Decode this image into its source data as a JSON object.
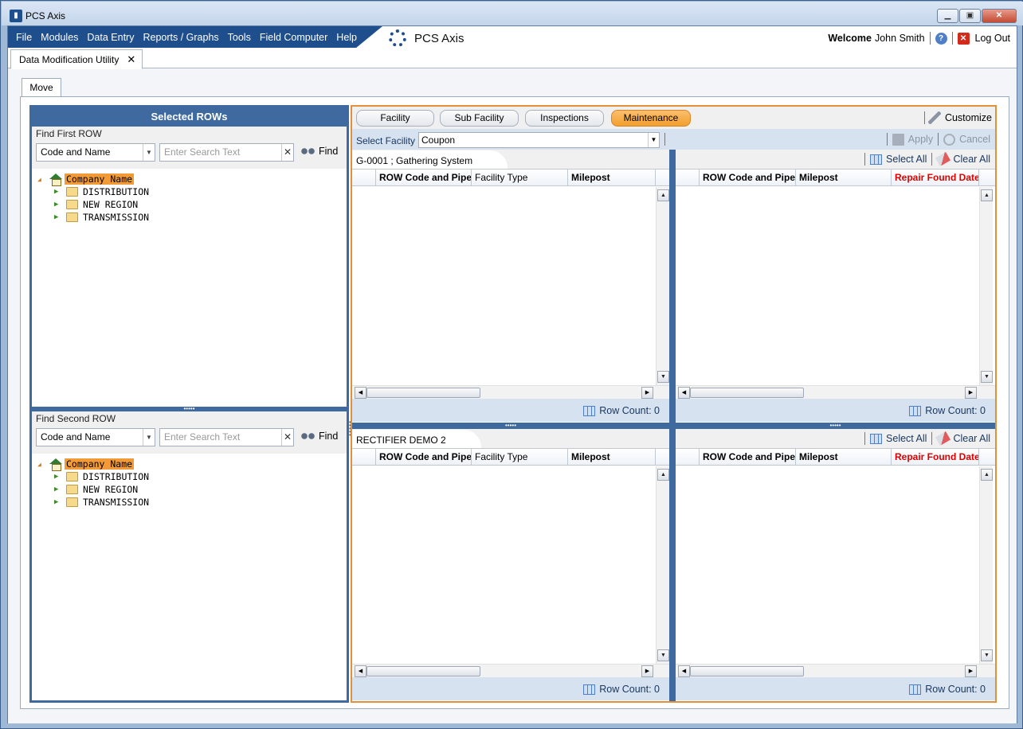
{
  "window": {
    "title": "PCS Axis",
    "app_icon": "pcs-app-icon"
  },
  "menu": {
    "items": [
      "File",
      "Modules",
      "Data Entry",
      "Reports / Graphs",
      "Tools",
      "Field Computer",
      "Help"
    ],
    "brand": "PCS Axis",
    "welcome": "Welcome",
    "user": "John Smith",
    "logout": "Log Out"
  },
  "doc_tab": {
    "label": "Data Modification Utility",
    "close": "✕"
  },
  "inner_tab": {
    "label": "Move"
  },
  "left": {
    "header": "Selected ROWs",
    "first": {
      "label": "Find First ROW",
      "mode": "Code and Name",
      "search_placeholder": "Enter Search Text",
      "find": "Find",
      "tree_root": "Company Name",
      "tree_items": [
        "DISTRIBUTION",
        "NEW REGION",
        "TRANSMISSION"
      ]
    },
    "second": {
      "label": "Find Second ROW",
      "mode": "Code and Name",
      "search_placeholder": "Enter Search Text",
      "find": "Find",
      "tree_root": "Company Name",
      "tree_items": [
        "DISTRIBUTION",
        "NEW REGION",
        "TRANSMISSION"
      ]
    }
  },
  "right": {
    "tabs": [
      "Facility",
      "Sub Facility",
      "Inspections",
      "Maintenance"
    ],
    "active_tab": "Maintenance",
    "customize": "Customize",
    "select_facility_label": "Select Facility",
    "facility_value": "Coupon",
    "apply": "Apply",
    "cancel": "Cancel",
    "top_left": {
      "title": "G-0001 ; Gathering System",
      "columns": [
        "ROW Code and Pipe",
        "Facility Type",
        "Milepost"
      ],
      "row_count": "Row Count:  0"
    },
    "top_right": {
      "select_all": "Select All",
      "clear_all": "Clear All",
      "columns": [
        "ROW Code and Pipe",
        "Milepost",
        "Repair Found Date"
      ],
      "row_count": "Row Count:  0"
    },
    "bottom_left": {
      "title": "RECTIFIER DEMO 2",
      "columns": [
        "ROW Code and Pipe",
        "Facility Type",
        "Milepost"
      ],
      "row_count": "Row Count:  0"
    },
    "bottom_right": {
      "select_all": "Select All",
      "clear_all": "Clear All",
      "columns": [
        "ROW Code and Pipe",
        "Milepost",
        "Repair Found Date"
      ],
      "row_count": "Row Count:  0"
    }
  },
  "colors": {
    "accent_blue": "#3e6a9f",
    "menu_blue": "#1f4e8c",
    "active_orange": "#f39f2d",
    "highlight_red": "#dd0000"
  }
}
